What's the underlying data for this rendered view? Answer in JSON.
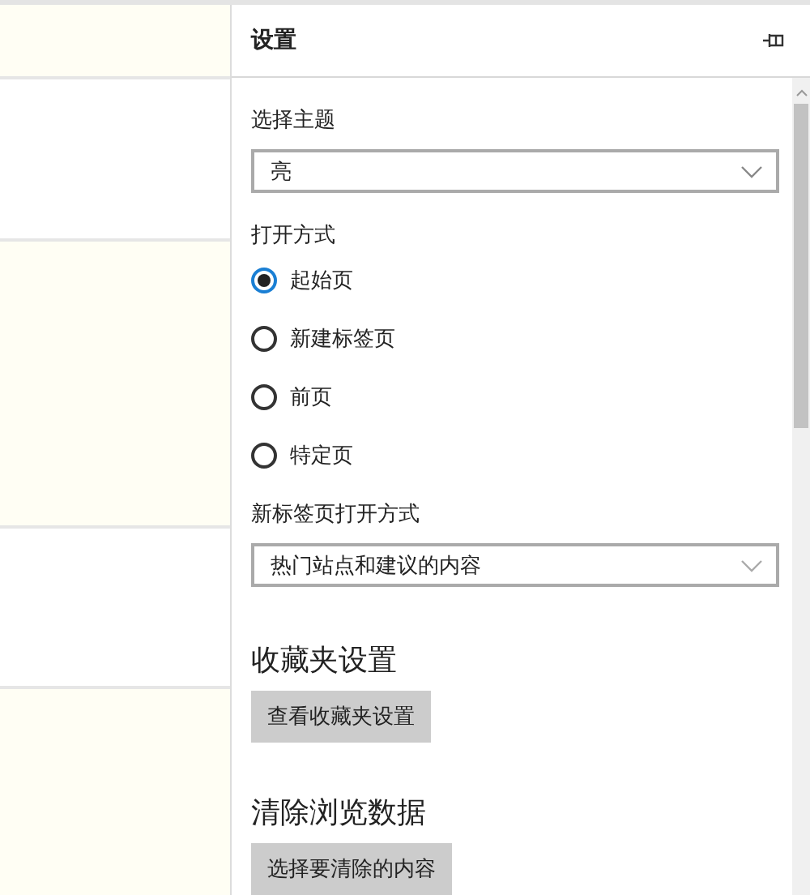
{
  "panel": {
    "title": "设置"
  },
  "theme": {
    "label": "选择主题",
    "value": "亮"
  },
  "open_with": {
    "label": "打开方式",
    "options": [
      {
        "label": "起始页",
        "selected": true
      },
      {
        "label": "新建标签页",
        "selected": false
      },
      {
        "label": "前页",
        "selected": false
      },
      {
        "label": "特定页",
        "selected": false
      }
    ]
  },
  "new_tab": {
    "label": "新标签页打开方式",
    "value": "热门站点和建议的内容"
  },
  "favorites": {
    "heading": "收藏夹设置",
    "button": "查看收藏夹设置"
  },
  "clear_data": {
    "heading": "清除浏览数据",
    "button": "选择要清除的内容"
  }
}
